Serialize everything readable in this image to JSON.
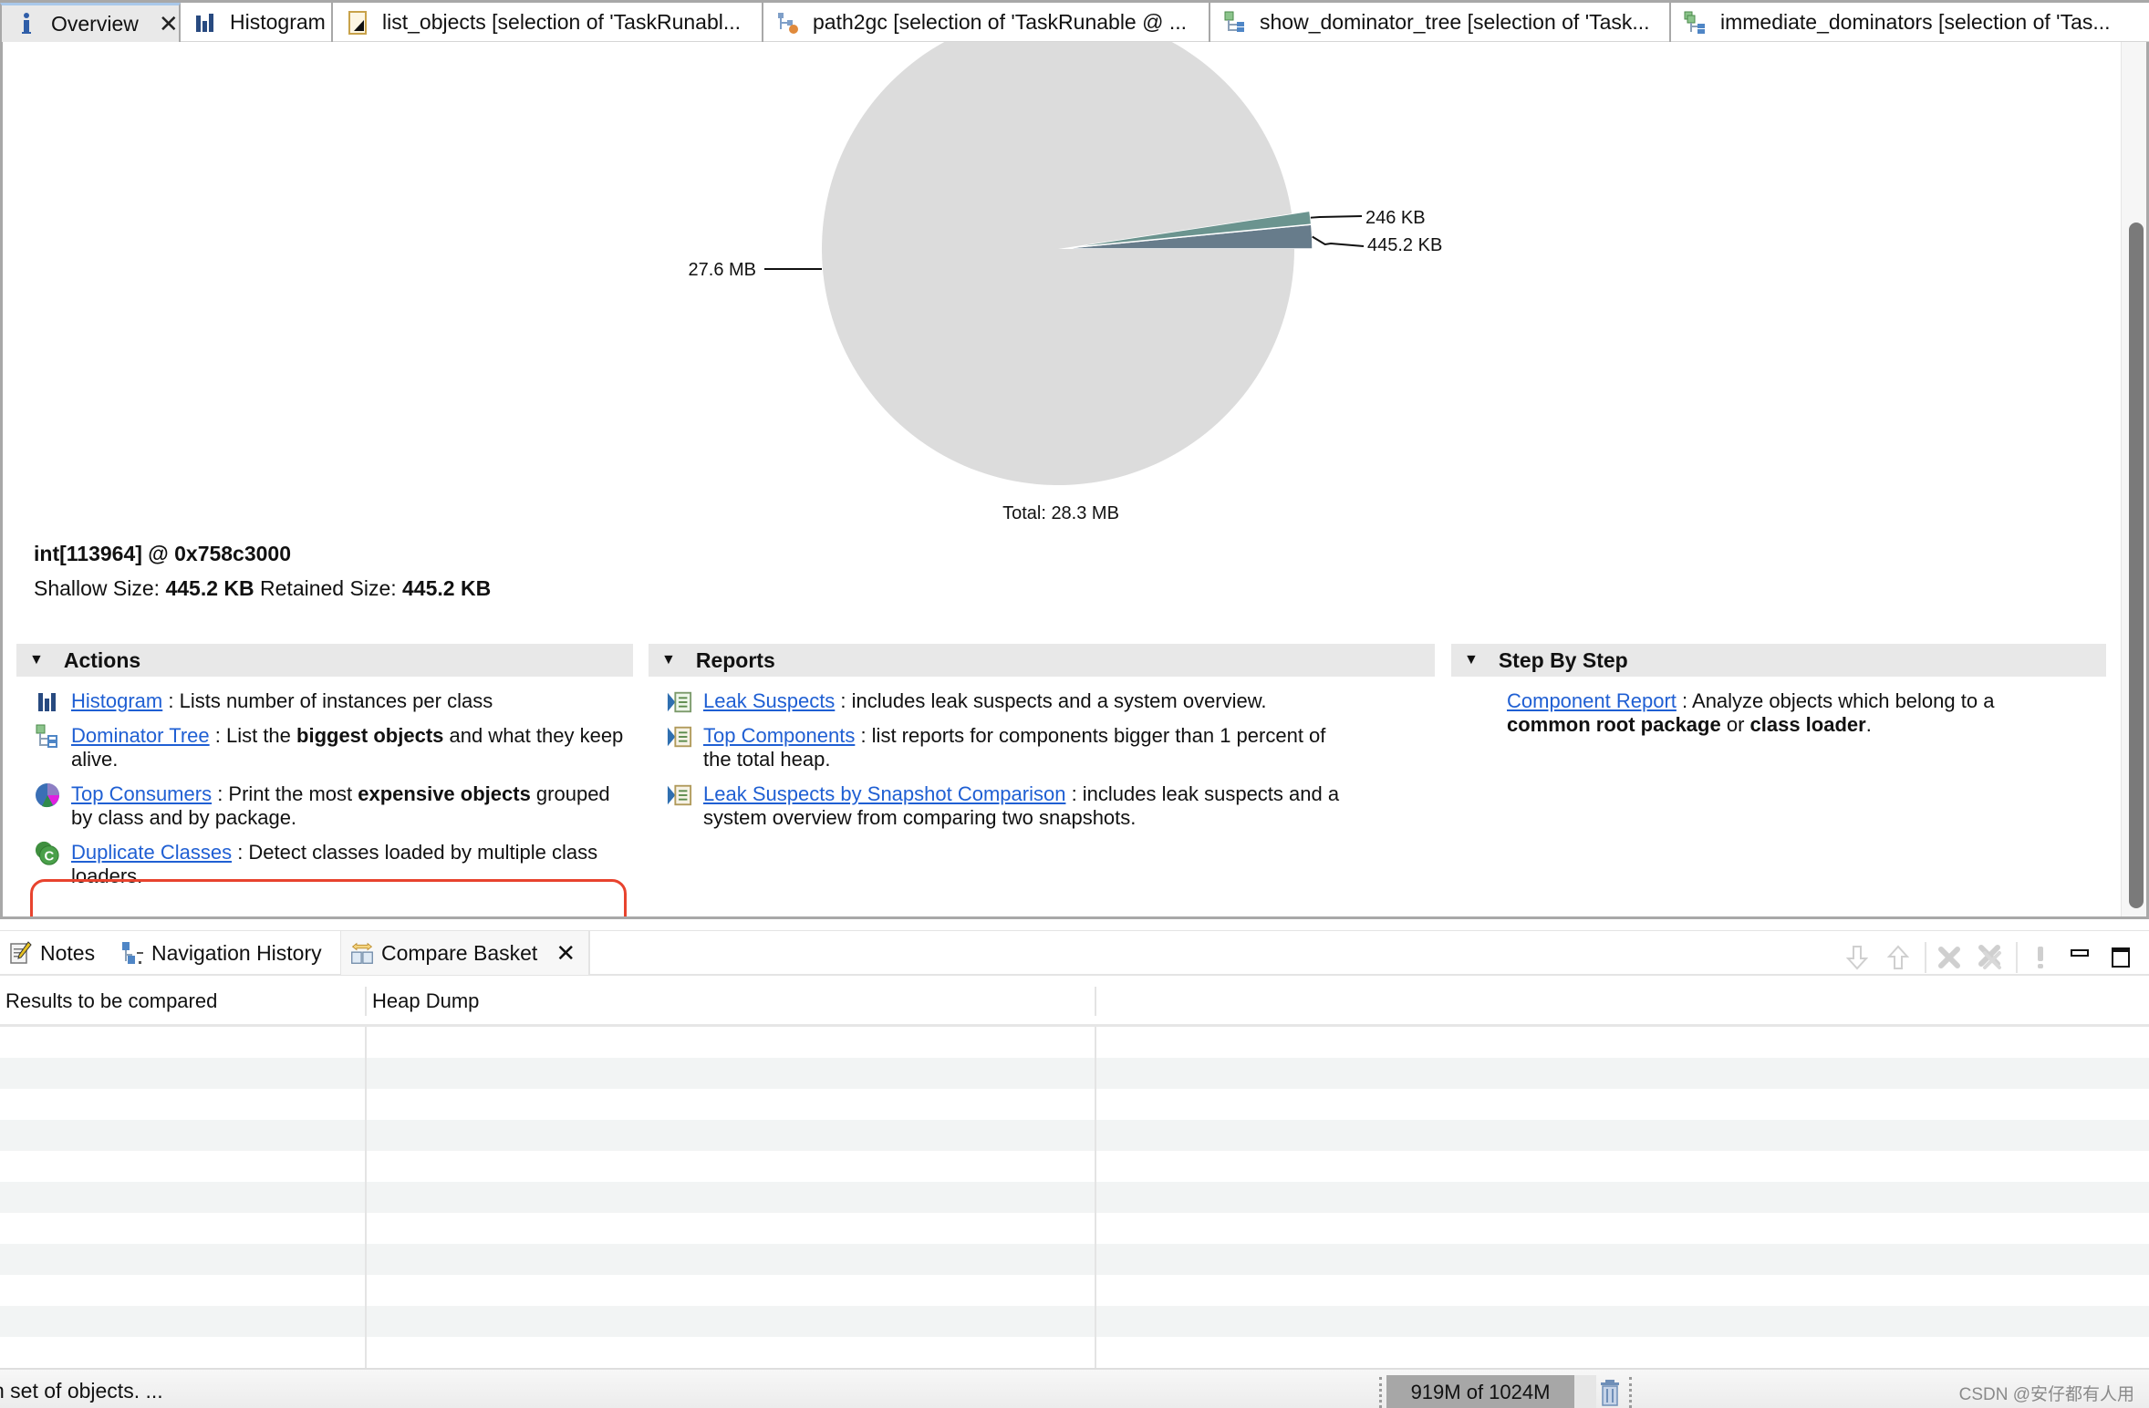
{
  "editor_tabs": [
    {
      "label": "Overview",
      "icon": "info-icon",
      "active": true,
      "closable": true
    },
    {
      "label": "Histogram",
      "icon": "histogram-icon",
      "active": false
    },
    {
      "label": "list_objects [selection of 'TaskRunabl...",
      "icon": "list-objects-icon",
      "active": false
    },
    {
      "label": "path2gc [selection of 'TaskRunable @ ...",
      "icon": "path2gc-icon",
      "active": false
    },
    {
      "label": "show_dominator_tree [selection of 'Task...",
      "icon": "dominator-tree-icon",
      "active": false
    },
    {
      "label": "immediate_dominators [selection of 'Tas...",
      "icon": "immediate-dominators-icon",
      "active": false
    }
  ],
  "close_glyph": "✕",
  "chart_data": {
    "type": "pie",
    "title": "",
    "total_label": "Total: 28.3 MB",
    "slices": [
      {
        "label": "27.6 MB",
        "value_kb": 28262.4,
        "color": "#dcdcdc"
      },
      {
        "label": "246 KB",
        "value_kb": 246,
        "color": "#6b948f"
      },
      {
        "label": "445.2 KB",
        "value_kb": 445.2,
        "color": "#677c8b"
      }
    ]
  },
  "selected_object": {
    "title": "int[113964] @ 0x758c3000",
    "shallow_label": "Shallow Size:",
    "shallow_value": "445.2 KB",
    "retained_label": "Retained Size:",
    "retained_value": "445.2 KB"
  },
  "sections": {
    "actions": {
      "title": "Actions",
      "items": [
        {
          "link": "Histogram",
          "sep": " : ",
          "text_parts": [
            {
              "t": "Lists number of instances per class",
              "b": false
            }
          ]
        },
        {
          "link": "Dominator Tree",
          "sep": " : ",
          "text_parts": [
            {
              "t": "List the ",
              "b": false
            },
            {
              "t": "biggest objects",
              "b": true
            },
            {
              "t": " and what they keep alive.",
              "b": false
            }
          ]
        },
        {
          "link": "Top Consumers",
          "sep": " : ",
          "text_parts": [
            {
              "t": "Print the most ",
              "b": false
            },
            {
              "t": "expensive objects",
              "b": true
            },
            {
              "t": " grouped by class and by package.",
              "b": false
            }
          ]
        },
        {
          "link": "Duplicate Classes",
          "sep": " : ",
          "text_parts": [
            {
              "t": "Detect classes loaded by multiple class loaders.",
              "b": false
            }
          ]
        }
      ]
    },
    "reports": {
      "title": "Reports",
      "items": [
        {
          "link": "Leak Suspects",
          "sep": " : ",
          "text": "includes leak suspects and a system overview."
        },
        {
          "link": "Top Components",
          "sep": " : ",
          "text": "list reports for components bigger than 1 percent of the total heap."
        },
        {
          "link": "Leak Suspects by Snapshot Comparison",
          "sep": " : ",
          "text": "includes leak suspects and a system overview from comparing two snapshots."
        }
      ]
    },
    "step_by_step": {
      "title": "Step By Step",
      "items": [
        {
          "link": "Component Report",
          "sep": " : ",
          "text_parts": [
            {
              "t": "Analyze objects which belong to a ",
              "b": false
            },
            {
              "t": "common root package",
              "b": true
            },
            {
              "t": " or ",
              "b": false
            },
            {
              "t": "class loader",
              "b": true
            },
            {
              "t": ".",
              "b": false
            }
          ]
        }
      ]
    }
  },
  "bottom_tabs": [
    {
      "label": "Notes",
      "icon": "notes-icon",
      "active": false
    },
    {
      "label": "Navigation History",
      "icon": "navigation-history-icon",
      "active": false
    },
    {
      "label": "Compare Basket",
      "icon": "compare-basket-icon",
      "active": true,
      "closable": true
    }
  ],
  "compare_table": {
    "columns": [
      "Results to be compared",
      "Heap Dump",
      ""
    ],
    "rows": []
  },
  "status_bar": {
    "message": "n set of objects. ...",
    "heap_usage": "919M of 1024M",
    "heap_used_fraction": 0.897,
    "watermark": "CSDN @安仔都有人用"
  }
}
